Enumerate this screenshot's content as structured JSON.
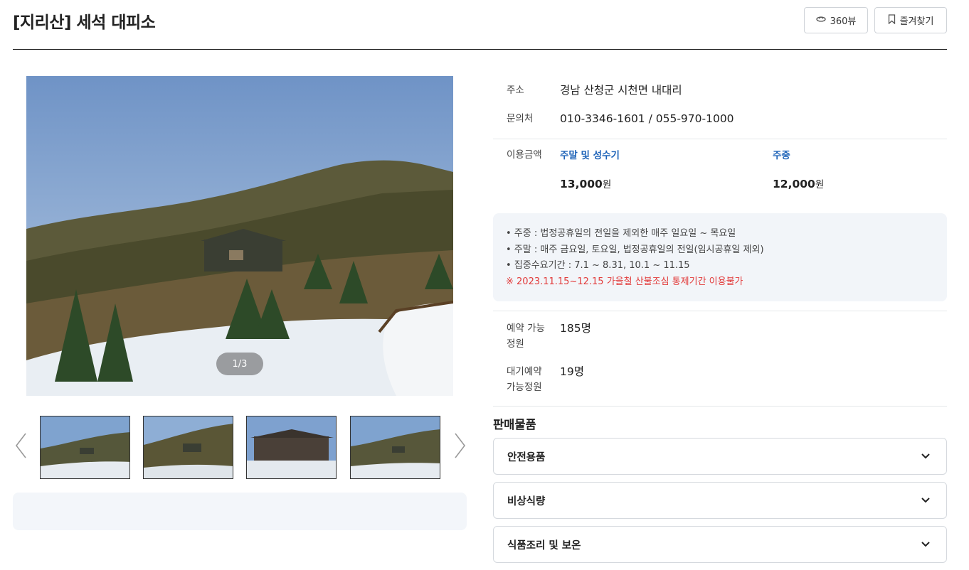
{
  "header": {
    "title": "[지리산] 세석 대피소",
    "buttons": {
      "view360": "360뷰",
      "favorite": "즐겨찾기"
    }
  },
  "gallery": {
    "counter": "1/3",
    "thumbnails": [
      "thumbnail-1",
      "thumbnail-2",
      "thumbnail-3",
      "thumbnail-4"
    ]
  },
  "info": {
    "address_label": "주소",
    "address": "경남 산청군 시천면 내대리",
    "contact_label": "문의처",
    "contact": "010-3346-1601 / 055-970-1000",
    "price_label": "이용금액",
    "prices": [
      {
        "label": "주말 및 성수기",
        "amount": "13,000",
        "unit": "원"
      },
      {
        "label": "주중",
        "amount": "12,000",
        "unit": "원"
      }
    ],
    "notices": [
      "• 주중 : 법정공휴일의 전일을 제외한 매주 일요일 ~ 목요일",
      "• 주말 : 매주 금요일, 토요일, 법정공휴일의 전일(임시공휴일 제외)",
      "• 집중수요기간 : 7.1 ~ 8.31, 10.1 ~ 11.15"
    ],
    "warning": "※ 2023.11.15~12.15 가을철 산불조심 통제기간 이용불가",
    "capacity_label_1": "예약 가능",
    "capacity_label_2": "정원",
    "capacity": "185명",
    "waiting_label_1": "대기예약",
    "waiting_label_2": "가능정원",
    "waiting": "19명"
  },
  "goods": {
    "title": "판매물품",
    "items": [
      "안전용품",
      "비상식량",
      "식품조리 및 보온"
    ]
  },
  "colors": {
    "accent": "#1e63b8",
    "warning": "#e23b3b",
    "notice_bg": "#f2f5f9"
  },
  "icons": {
    "view360": "360-view-icon",
    "favorite": "bookmark-icon",
    "prev": "chevron-left-icon",
    "next": "chevron-right-icon",
    "expand": "chevron-down-icon"
  }
}
